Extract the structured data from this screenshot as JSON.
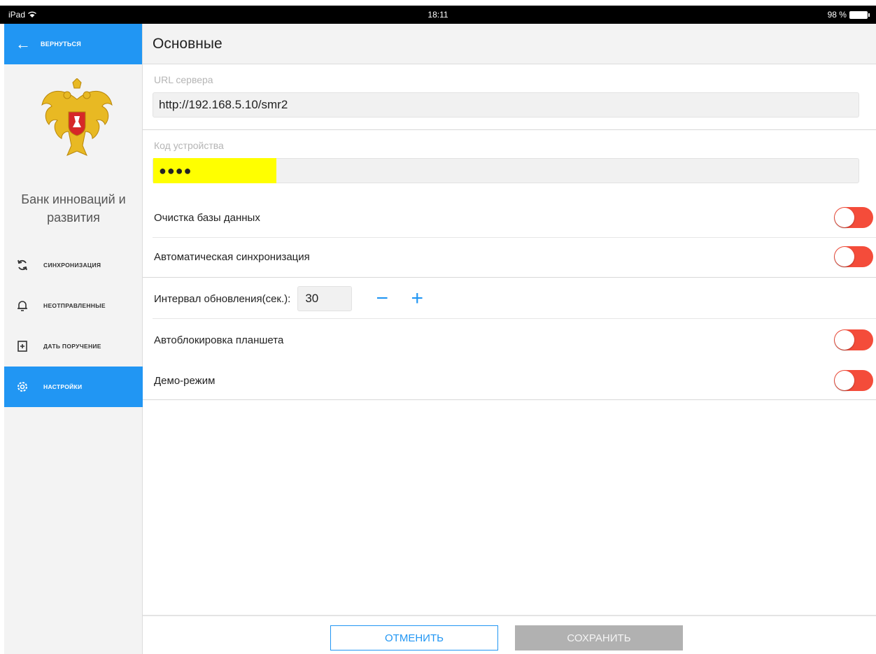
{
  "statusbar": {
    "device": "iPad",
    "time": "18:11",
    "battery": "98 %"
  },
  "sidebar": {
    "back_label": "ВЕРНУТЬСЯ",
    "org_name_line1": "Банк инноваций и",
    "org_name_line2": "развития",
    "items": [
      {
        "label": "СИНХРОНИЗАЦИЯ",
        "icon": "sync-icon"
      },
      {
        "label": "НЕОТПРАВЛЕННЫЕ",
        "icon": "bell-icon"
      },
      {
        "label": "ДАТЬ ПОРУЧЕНИЕ",
        "icon": "add-task-icon"
      },
      {
        "label": "НАСТРОЙКИ",
        "icon": "gear-icon",
        "active": true
      }
    ]
  },
  "main": {
    "title": "Основные",
    "server_url": {
      "label": "URL сервера",
      "value": "http://192.168.5.10/smr2"
    },
    "device_code": {
      "label": "Код устройства",
      "value": "●●●●"
    },
    "settings": {
      "clear_db": {
        "label": "Очистка базы данных"
      },
      "auto_sync": {
        "label": "Автоматическая синхронизация"
      },
      "interval": {
        "label": "Интервал обновления(сек.):",
        "value": "30",
        "minus": "−",
        "plus": "+"
      },
      "auto_lock": {
        "label": "Автоблокировка планшета"
      },
      "demo": {
        "label": "Демо-режим"
      }
    },
    "buttons": {
      "cancel": "ОТМЕНИТЬ",
      "save": "СОХРАНИТЬ"
    }
  },
  "colors": {
    "accent": "#2196f3",
    "toggle": "#f44c3a",
    "highlight": "#ffff00"
  }
}
